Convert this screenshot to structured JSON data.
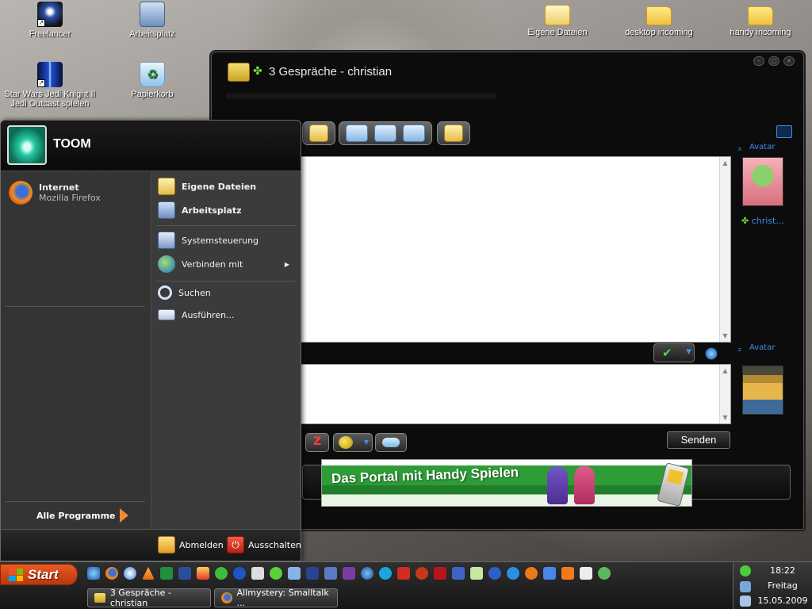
{
  "desktop": {
    "icons": [
      {
        "label": "Freelancer",
        "icon": "freelancer-icon"
      },
      {
        "label": "Arbeitsplatz",
        "icon": "computer-icon"
      },
      {
        "label": "Star Wars Jedi Knight II Jedi Outcast spielen",
        "icon": "star-wars-icon"
      },
      {
        "label": "Papierkorb",
        "icon": "recycle-bin-icon"
      },
      {
        "label": "Eigene Dateien",
        "icon": "my-documents-icon"
      },
      {
        "label": "desktop incoming",
        "icon": "folder-icon"
      },
      {
        "label": "handy incoming",
        "icon": "folder-icon"
      }
    ]
  },
  "chat": {
    "title": "3 Gespräche - christian",
    "avatar_label": "Avatar",
    "contact_name": "christ...",
    "send_label": "Senden",
    "banner_text": "Das Portal mit Handy Spielen"
  },
  "start_menu": {
    "user": "TOOM",
    "pinned": {
      "title": "Internet",
      "subtitle": "Mozilla Firefox"
    },
    "all_programs": "Alle Programme",
    "right_items": [
      {
        "label": "Eigene Dateien",
        "bold": true
      },
      {
        "label": "Arbeitsplatz",
        "bold": true
      },
      {
        "label": "Systemsteuerung",
        "bold": false
      },
      {
        "label": "Verbinden mit",
        "bold": false
      },
      {
        "label": "Suchen",
        "bold": false
      },
      {
        "label": "Ausführen...",
        "bold": false
      }
    ],
    "logout_label": "Abmelden",
    "shutdown_label": "Ausschalten"
  },
  "taskbar": {
    "start_label": "Start",
    "tasks": [
      {
        "label": "3 Gespräche - christian"
      },
      {
        "label": "Allmystery: Smalltalk ..."
      }
    ],
    "clock": {
      "time": "18:22",
      "day": "Freitag",
      "date": "15.05.2009"
    }
  },
  "colors": {
    "start_button": "#d2491a",
    "chat_bg": "#0c0c0c",
    "accent_blue": "#3c8cf0"
  }
}
